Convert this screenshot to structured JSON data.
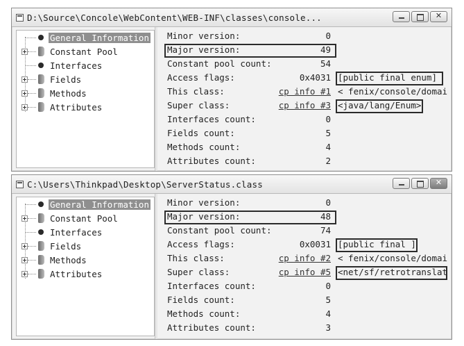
{
  "windows": [
    {
      "title": "D:\\Source\\Concole\\WebContent\\WEB-INF\\classes\\console...",
      "tree": [
        "General Information",
        "Constant Pool",
        "Interfaces",
        "Fields",
        "Methods",
        "Attributes"
      ],
      "rows": [
        {
          "key": "Minor version:",
          "value": "0",
          "extra": ""
        },
        {
          "key": "Major version:",
          "value": "49",
          "extra": ""
        },
        {
          "key": "Constant pool count:",
          "value": "54",
          "extra": ""
        },
        {
          "key": "Access flags:",
          "value": "0x4031",
          "extra": "[public final  enum]"
        },
        {
          "key": "This class:",
          "value": "cp info #1",
          "extra": "< fenix/console/domai"
        },
        {
          "key": "Super class:",
          "value": "cp info #3",
          "extra": "<java/lang/Enum>"
        },
        {
          "key": "Interfaces count:",
          "value": "0",
          "extra": ""
        },
        {
          "key": "Fields count:",
          "value": "5",
          "extra": ""
        },
        {
          "key": "Methods count:",
          "value": "4",
          "extra": ""
        },
        {
          "key": "Attributes count:",
          "value": "2",
          "extra": ""
        }
      ]
    },
    {
      "title": "C:\\Users\\Thinkpad\\Desktop\\ServerStatus.class",
      "tree": [
        "General Information",
        "Constant Pool",
        "Interfaces",
        "Fields",
        "Methods",
        "Attributes"
      ],
      "rows": [
        {
          "key": "Minor version:",
          "value": "0",
          "extra": ""
        },
        {
          "key": "Major version:",
          "value": "48",
          "extra": ""
        },
        {
          "key": "Constant pool count:",
          "value": "74",
          "extra": ""
        },
        {
          "key": "Access flags:",
          "value": "0x0031",
          "extra": "[public final ]"
        },
        {
          "key": "This class:",
          "value": "cp info #2",
          "extra": "< fenix/console/domai"
        },
        {
          "key": "Super class:",
          "value": "cp info #5",
          "extra": "<net/sf/retrotranslat"
        },
        {
          "key": "Interfaces count:",
          "value": "0",
          "extra": ""
        },
        {
          "key": "Fields count:",
          "value": "5",
          "extra": ""
        },
        {
          "key": "Methods count:",
          "value": "4",
          "extra": ""
        },
        {
          "key": "Attributes count:",
          "value": "3",
          "extra": ""
        }
      ]
    }
  ]
}
